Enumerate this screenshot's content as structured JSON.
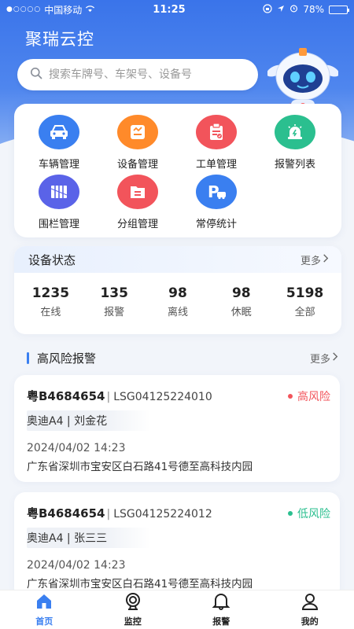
{
  "status_bar": {
    "carrier": "中国移动",
    "time": "11:25",
    "battery": "78%",
    "battery_level": 0.78
  },
  "header": {
    "title": "聚瑞云控",
    "search_placeholder": "搜索车牌号、车架号、设备号"
  },
  "menu": [
    {
      "label": "车辆管理",
      "icon": "car-icon",
      "color": "#3a7ff0"
    },
    {
      "label": "设备管理",
      "icon": "device-icon",
      "color": "#ff8a2a"
    },
    {
      "label": "工单管理",
      "icon": "work-order-icon",
      "color": "#f2545b"
    },
    {
      "label": "报警列表",
      "icon": "alarm-list-icon",
      "color": "#2bbf8f"
    },
    {
      "label": "围栏管理",
      "icon": "fence-icon",
      "color": "#5a63e8"
    },
    {
      "label": "分组管理",
      "icon": "group-icon",
      "color": "#f2545b"
    },
    {
      "label": "常停统计",
      "icon": "parking-icon",
      "color": "#3a7ff0"
    }
  ],
  "device_status": {
    "title": "设备状态",
    "more": "更多",
    "stats": [
      {
        "value": "1235",
        "label": "在线"
      },
      {
        "value": "135",
        "label": "报警"
      },
      {
        "value": "98",
        "label": "离线"
      },
      {
        "value": "98",
        "label": "休眠"
      },
      {
        "value": "5198",
        "label": "全部"
      }
    ]
  },
  "high_risk": {
    "title": "高风险报警",
    "more": "更多",
    "alarms": [
      {
        "plate": "粤B4684654",
        "vin": "LSG04125224010",
        "risk": "高风险",
        "risk_color": "#f2545b",
        "car": "奥迪A4",
        "owner": "刘金花",
        "time": "2024/04/02 14:23",
        "address": "广东省深圳市宝安区白石路41号德至高科技内园"
      },
      {
        "plate": "粤B4684654",
        "vin": "LSG04125224012",
        "risk": "低风险",
        "risk_color": "#2bbf8f",
        "car": "奥迪A4",
        "owner": "张三三",
        "time": "2024/04/02 14:23",
        "address": "广东省深圳市宝安区白石路41号德至高科技内园"
      }
    ]
  },
  "tabbar": [
    {
      "label": "首页",
      "icon": "home-icon",
      "active": true
    },
    {
      "label": "监控",
      "icon": "monitor-icon",
      "active": false
    },
    {
      "label": "报警",
      "icon": "bell-icon",
      "active": false
    },
    {
      "label": "我的",
      "icon": "user-icon",
      "active": false
    }
  ],
  "colors": {
    "primary": "#3a74ea",
    "text": "#222222",
    "active_tab": "#3a7ff0"
  }
}
